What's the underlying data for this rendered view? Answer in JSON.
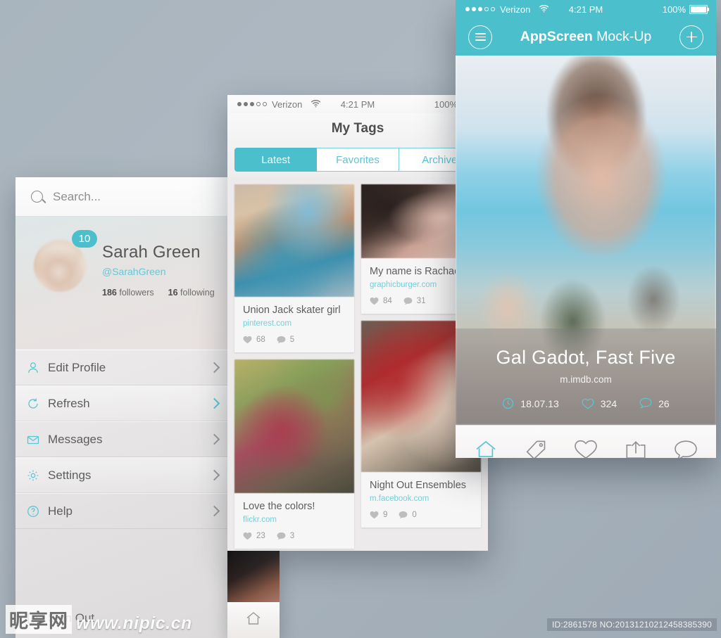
{
  "background_color": "#abb6bf",
  "accent_color": "#4cbfcd",
  "left_phone": {
    "search": {
      "placeholder": "Search...",
      "icon": "search-icon"
    },
    "profile": {
      "badge_count": "10",
      "name": "Sarah Green",
      "handle": "@SarahGreen",
      "followers_count": "186",
      "followers_label": "followers",
      "following_count": "16",
      "following_label": "following"
    },
    "menu": [
      {
        "label": "Edit Profile",
        "icon": "user-icon"
      },
      {
        "label": "Refresh",
        "icon": "refresh-icon"
      },
      {
        "label": "Messages",
        "icon": "envelope-icon"
      },
      {
        "label": "Settings",
        "icon": "gear-icon"
      },
      {
        "label": "Help",
        "icon": "question-circle-icon"
      }
    ],
    "sign_out": {
      "label": "Sign Out",
      "icon": "sign-out-icon"
    }
  },
  "middle_phone": {
    "status": {
      "carrier": "Verizon",
      "time": "4:21 PM",
      "battery": "100%",
      "wifi_icon": "wifi-icon"
    },
    "title": "My Tags",
    "tabs": [
      {
        "label": "Latest",
        "active": true
      },
      {
        "label": "Favorites",
        "active": false
      },
      {
        "label": "Archive",
        "active": false
      }
    ],
    "cards": [
      {
        "title": "Union Jack skater girl",
        "source": "pinterest.com",
        "likes": "68",
        "comments": "5",
        "column": "left"
      },
      {
        "title": "My name is Rachael",
        "source": "graphicburger.com",
        "likes": "84",
        "comments": "31",
        "column": "right"
      },
      {
        "title": "Love the colors!",
        "source": "flickr.com",
        "likes": "23",
        "comments": "3",
        "column": "left"
      },
      {
        "title": "Night Out Ensembles",
        "source": "m.facebook.com",
        "likes": "9",
        "comments": "0",
        "column": "right"
      }
    ]
  },
  "right_phone": {
    "status": {
      "carrier": "Verizon",
      "time": "4:21 PM",
      "battery": "100%",
      "wifi_icon": "wifi-icon"
    },
    "header": {
      "title_bold": "AppScreen",
      "title_rest": " Mock-Up",
      "menu_icon": "hamburger-icon",
      "add_icon": "plus-icon"
    },
    "hero": {
      "title": "Gal Gadot, Fast Five",
      "source": "m.imdb.com",
      "date": "18.07.13",
      "likes": "324",
      "comments": "26",
      "date_icon": "clock-icon",
      "likes_icon": "heart-icon",
      "comments_icon": "comment-icon"
    },
    "tabbar": [
      {
        "icon": "home-icon",
        "active": true
      },
      {
        "icon": "tag-icon",
        "active": false
      },
      {
        "icon": "heart-icon",
        "active": false
      },
      {
        "icon": "share-icon",
        "active": false
      },
      {
        "icon": "comment-icon",
        "active": false
      }
    ]
  },
  "watermark": {
    "site_cn": "昵享网",
    "site_url": "www.nipic.cn",
    "id_text": "ID:2861578 NO:20131210212458385390"
  }
}
